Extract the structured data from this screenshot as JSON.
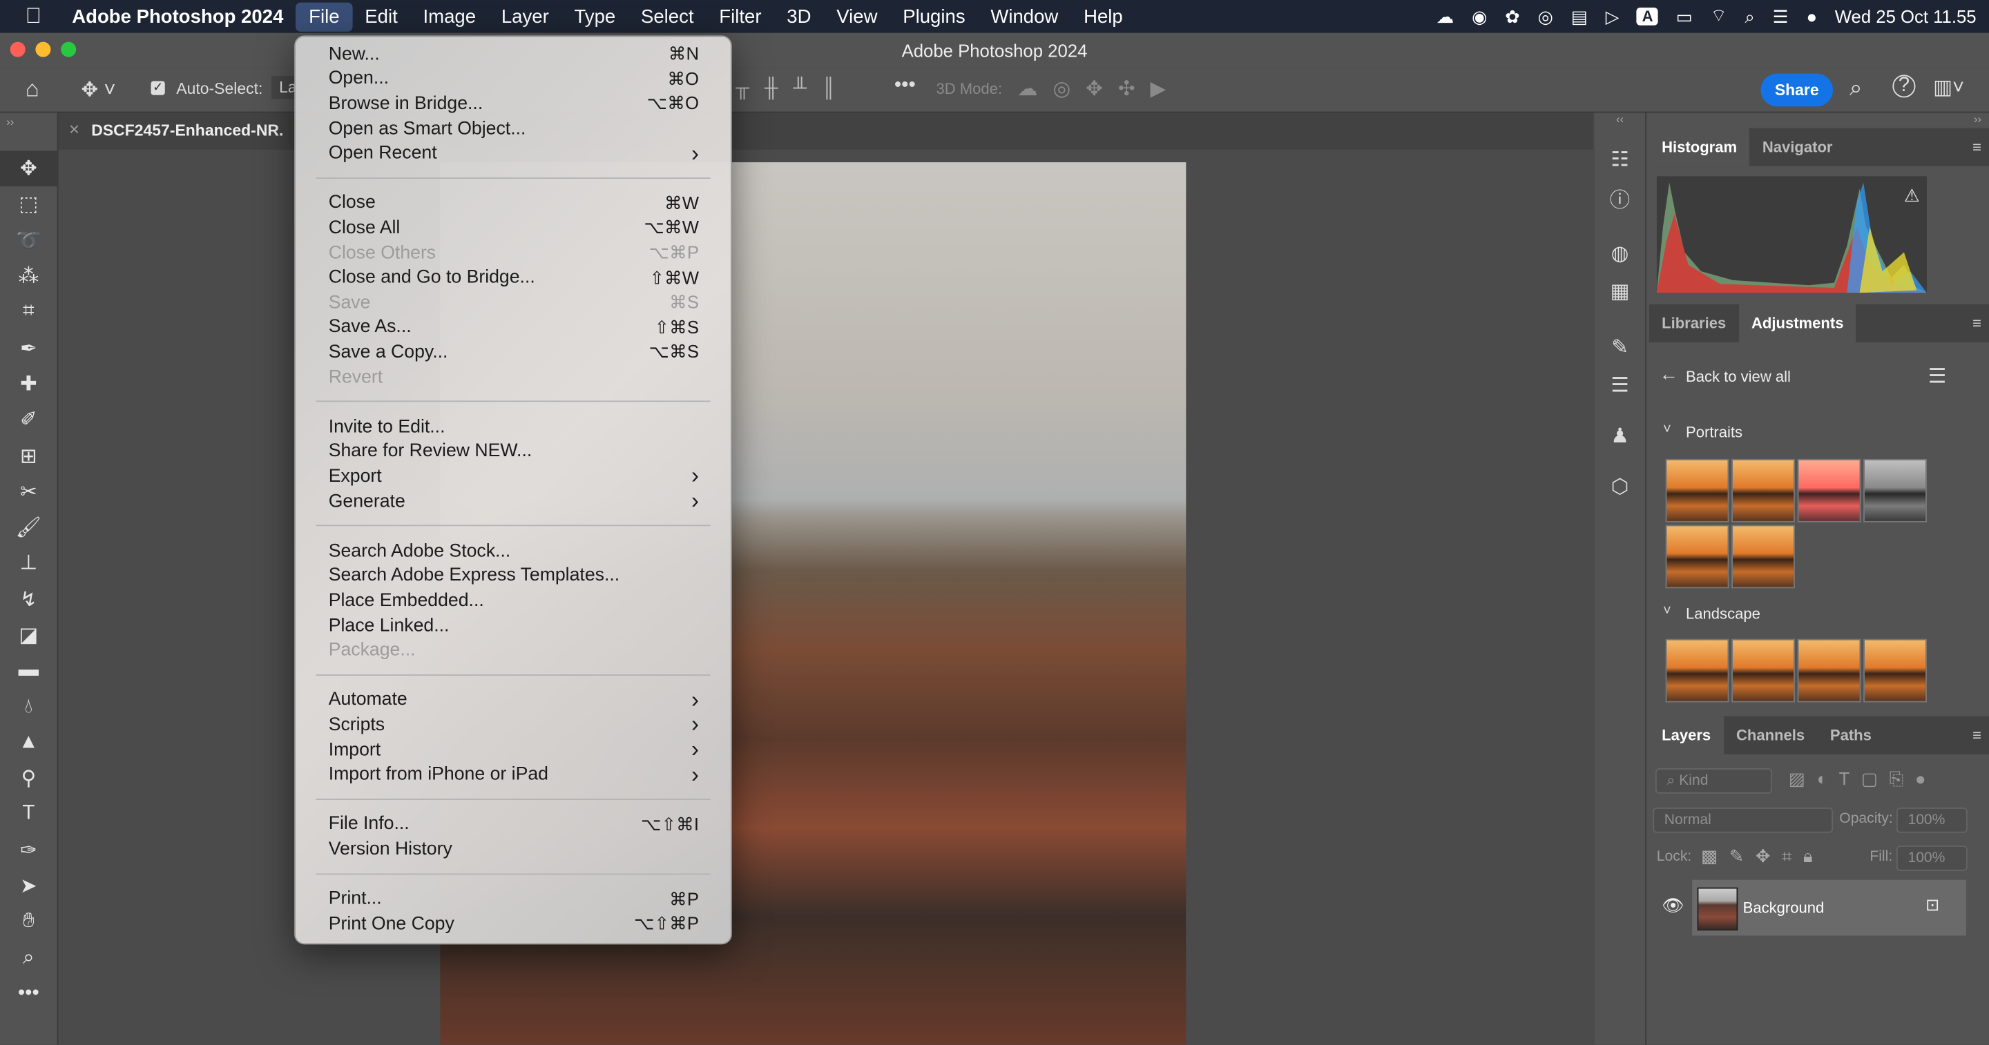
{
  "menubar": {
    "app": "Adobe Photoshop 2024",
    "items": [
      "File",
      "Edit",
      "Image",
      "Layer",
      "Type",
      "Select",
      "Filter",
      "3D",
      "View",
      "Plugins",
      "Window",
      "Help"
    ],
    "active": "File",
    "clock": "Wed 25 Oct  11.55",
    "input_source": "A"
  },
  "window": {
    "title": "Adobe Photoshop 2024"
  },
  "options": {
    "auto_select_label": "Auto-Select:",
    "auto_select_value": "La",
    "mode_3d": "3D Mode:",
    "share": "Share"
  },
  "document_tab": "DSCF2457-Enhanced-NR.",
  "menu": {
    "groups": [
      [
        {
          "label": "New...",
          "sc": "⌘N"
        },
        {
          "label": "Open...",
          "sc": "⌘O"
        },
        {
          "label": "Browse in Bridge...",
          "sc": "⌥⌘O"
        },
        {
          "label": "Open as Smart Object..."
        },
        {
          "label": "Open Recent",
          "sub": true
        }
      ],
      [
        {
          "label": "Close",
          "sc": "⌘W"
        },
        {
          "label": "Close All",
          "sc": "⌥⌘W"
        },
        {
          "label": "Close Others",
          "sc": "⌥⌘P",
          "disabled": true
        },
        {
          "label": "Close and Go to Bridge...",
          "sc": "⇧⌘W"
        },
        {
          "label": "Save",
          "sc": "⌘S",
          "disabled": true
        },
        {
          "label": "Save As...",
          "sc": "⇧⌘S"
        },
        {
          "label": "Save a Copy...",
          "sc": "⌥⌘S"
        },
        {
          "label": "Revert",
          "disabled": true
        }
      ],
      [
        {
          "label": "Invite to Edit..."
        },
        {
          "label": "Share for Review NEW..."
        },
        {
          "label": "Export",
          "sub": true
        },
        {
          "label": "Generate",
          "sub": true
        }
      ],
      [
        {
          "label": "Search Adobe Stock..."
        },
        {
          "label": "Search Adobe Express Templates..."
        },
        {
          "label": "Place Embedded..."
        },
        {
          "label": "Place Linked..."
        },
        {
          "label": "Package...",
          "disabled": true
        }
      ],
      [
        {
          "label": "Automate",
          "sub": true
        },
        {
          "label": "Scripts",
          "sub": true
        },
        {
          "label": "Import",
          "sub": true
        },
        {
          "label": "Import from iPhone or iPad",
          "sub": true
        }
      ],
      [
        {
          "label": "File Info...",
          "sc": "⌥⇧⌘I"
        },
        {
          "label": "Version History"
        }
      ],
      [
        {
          "label": "Print...",
          "sc": "⌘P"
        },
        {
          "label": "Print One Copy",
          "sc": "⌥⇧⌘P"
        }
      ]
    ]
  },
  "tools": [
    "move",
    "marquee",
    "lasso",
    "magic-wand",
    "crop",
    "eyedropper",
    "healing",
    "brush-heal",
    "frame",
    "content-aware",
    "brush",
    "stamp",
    "history-brush",
    "eraser",
    "gradient",
    "blur",
    "sharpen",
    "dodge",
    "type",
    "pen",
    "path-select",
    "hand",
    "zoom",
    "more"
  ],
  "panels": {
    "top_tabs": [
      "Histogram",
      "Navigator"
    ],
    "mid_tabs": [
      "Libraries",
      "Adjustments"
    ],
    "back": "Back to view all",
    "portraits": "Portraits",
    "landscape": "Landscape",
    "layer_tabs": [
      "Layers",
      "Channels",
      "Paths"
    ],
    "kind": "Kind",
    "blend": "Normal",
    "opacity_label": "Opacity:",
    "opacity": "100%",
    "lock_label": "Lock:",
    "fill_label": "Fill:",
    "fill": "100%",
    "layer_name": "Background"
  },
  "colors": {
    "accent": "#1473e6",
    "menubar": "#1d2433"
  }
}
